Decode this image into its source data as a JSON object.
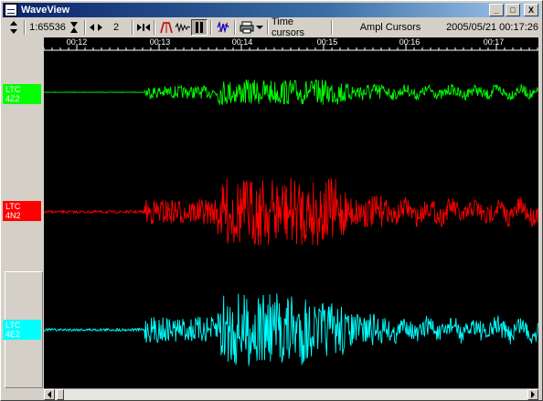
{
  "window": {
    "title": "WaveView",
    "controls": [
      "_",
      "□",
      "X"
    ]
  },
  "toolbar": {
    "scale_value": "1:65536",
    "zoom_value": "2",
    "time_cursors_label": "Time cursors",
    "ampl_cursors_label": "Ampl Cursors",
    "datetime": "2005/05/21 00:17:26"
  },
  "time_axis": {
    "ticks": [
      "00:12",
      "00:13",
      "00:14",
      "00:15",
      "00:16",
      "00:17"
    ]
  },
  "channels": [
    {
      "station": "LTC",
      "component": "4Z2",
      "color": "#00ff00"
    },
    {
      "station": "LTC",
      "component": "4N2",
      "color": "#ff0000"
    },
    {
      "station": "LTC",
      "component": "4E2",
      "color": "#00ffff"
    }
  ],
  "colors": {
    "plot_background": "#000000",
    "title_bar": "#0a246a"
  },
  "icons": {
    "updown": "updown-arrows-icon",
    "hourglass": "hourglass-icon",
    "leftright": "leftright-arrows-icon",
    "zoom_fit": "fit-arrows-icon",
    "pick": "pick-icon",
    "wave": "wave-icon",
    "pause": "pause-icon",
    "filter": "filter-icon",
    "print": "printer-icon",
    "dropdown": "dropdown-arrow-icon"
  }
}
